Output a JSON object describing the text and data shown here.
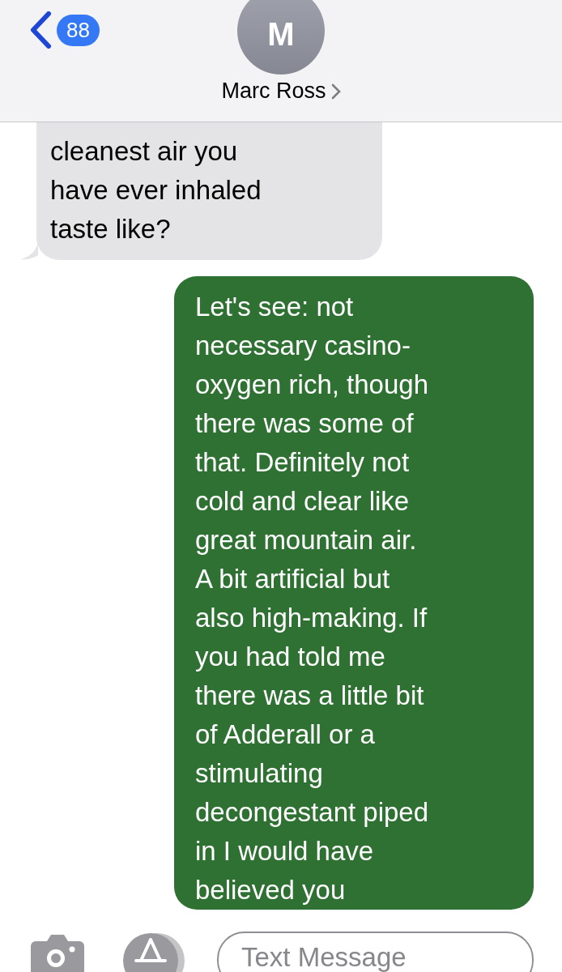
{
  "header": {
    "back_badge": "88",
    "avatar_initial": "M",
    "contact_name": "Marc Ross"
  },
  "messages": [
    {
      "kind": "received",
      "text": "cleanest air you\nhave ever inhaled\ntaste like?"
    },
    {
      "kind": "sent",
      "text": "Let's see: not\nnecessary casino-\noxygen rich, though\nthere was some of\nthat. Definitely not\ncold and clear like\ngreat mountain air.\nA bit artificial but\nalso high-making. If\nyou had told me\nthere was a little bit\nof Adderall or a\nstimulating\ndecongestant piped\nin I would have\nbelieved you"
    }
  ],
  "composer": {
    "placeholder": "Text Message"
  }
}
